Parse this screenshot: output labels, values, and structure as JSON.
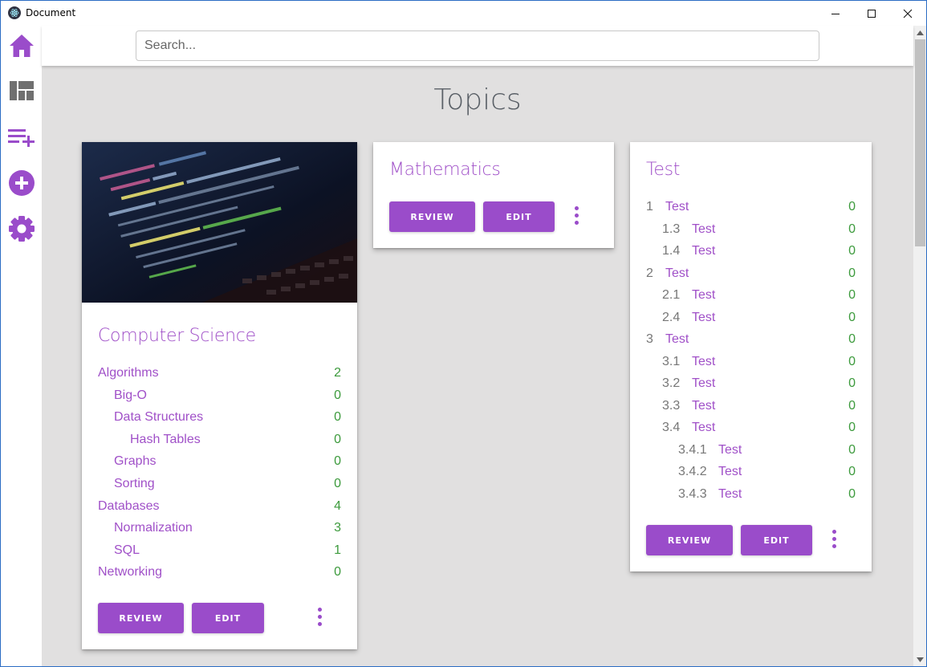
{
  "window": {
    "title": "Document"
  },
  "search": {
    "placeholder": "Search..."
  },
  "sidebar": {
    "items": [
      {
        "icon": "home-icon"
      },
      {
        "icon": "dashboard-icon"
      },
      {
        "icon": "playlist-add-icon"
      },
      {
        "icon": "add-circle-icon"
      },
      {
        "icon": "gear-icon"
      }
    ]
  },
  "colors": {
    "accent": "#9a4cca",
    "count": "#3c9a3c",
    "background": "#e1e0e0"
  },
  "main": {
    "title": "Topics",
    "cards": {
      "cs": {
        "title": "Computer Science",
        "topics": [
          {
            "name": "Algorithms",
            "count": "2"
          },
          {
            "name": "Big-O",
            "count": "0"
          },
          {
            "name": "Data Structures",
            "count": "0"
          },
          {
            "name": "Hash Tables",
            "count": "0"
          },
          {
            "name": "Graphs",
            "count": "0"
          },
          {
            "name": "Sorting",
            "count": "0"
          },
          {
            "name": "Databases",
            "count": "4"
          },
          {
            "name": "Normalization",
            "count": "3"
          },
          {
            "name": "SQL",
            "count": "1"
          },
          {
            "name": "Networking",
            "count": "0"
          }
        ],
        "review_label": "REVIEW",
        "edit_label": "EDIT"
      },
      "math": {
        "title": "Mathematics",
        "review_label": "REVIEW",
        "edit_label": "EDIT"
      },
      "test": {
        "title": "Test",
        "topics": [
          {
            "num": "1",
            "name": "Test",
            "count": "0"
          },
          {
            "num": "1.3",
            "name": "Test",
            "count": "0"
          },
          {
            "num": "1.4",
            "name": "Test",
            "count": "0"
          },
          {
            "num": "2",
            "name": "Test",
            "count": "0"
          },
          {
            "num": "2.1",
            "name": "Test",
            "count": "0"
          },
          {
            "num": "2.4",
            "name": "Test",
            "count": "0"
          },
          {
            "num": "3",
            "name": "Test",
            "count": "0"
          },
          {
            "num": "3.1",
            "name": "Test",
            "count": "0"
          },
          {
            "num": "3.2",
            "name": "Test",
            "count": "0"
          },
          {
            "num": "3.3",
            "name": "Test",
            "count": "0"
          },
          {
            "num": "3.4",
            "name": "Test",
            "count": "0"
          },
          {
            "num": "3.4.1",
            "name": "Test",
            "count": "0"
          },
          {
            "num": "3.4.2",
            "name": "Test",
            "count": "0"
          },
          {
            "num": "3.4.3",
            "name": "Test",
            "count": "0"
          }
        ],
        "review_label": "REVIEW",
        "edit_label": "EDIT"
      }
    }
  }
}
